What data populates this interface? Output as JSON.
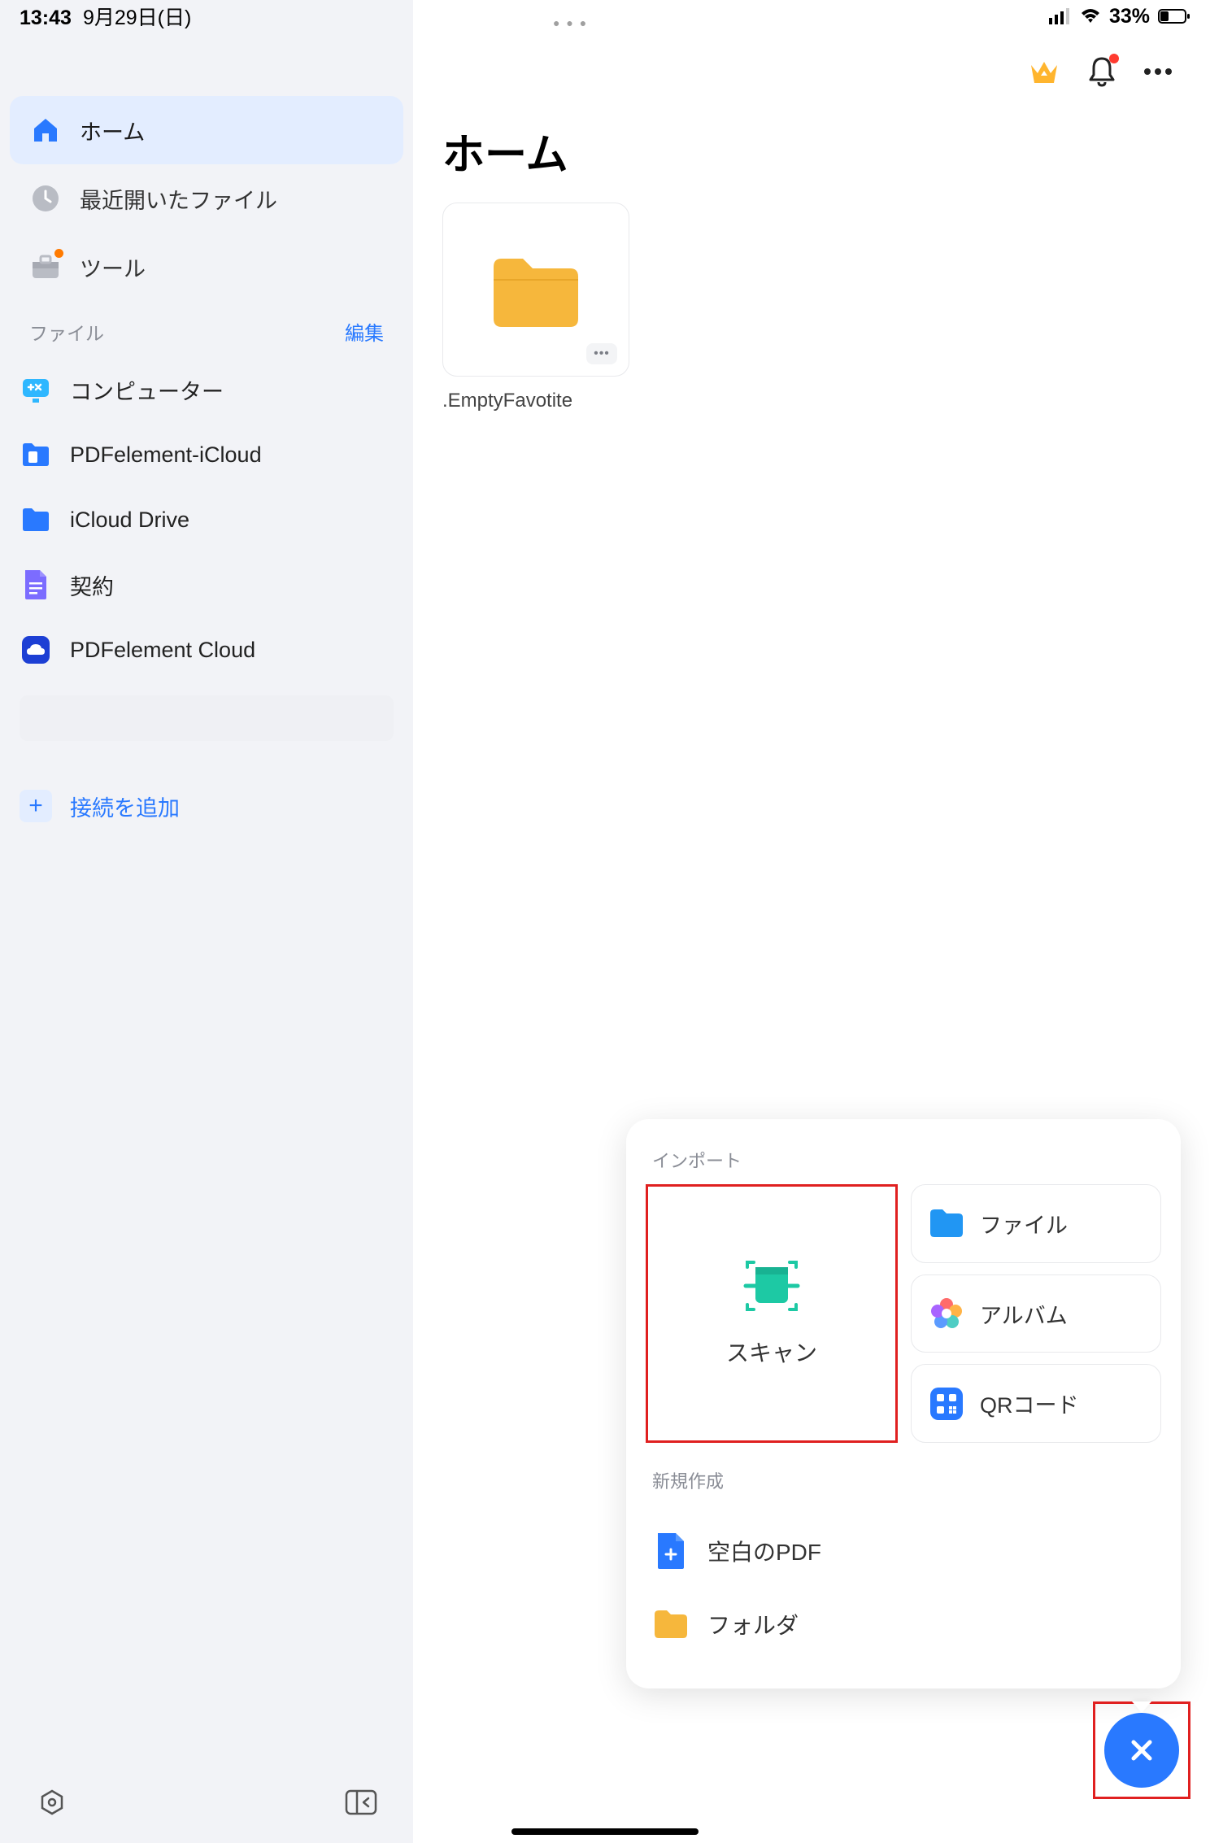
{
  "status": {
    "time": "13:43",
    "date": "9月29日(日)",
    "battery": "33%"
  },
  "sidebar": {
    "nav": [
      {
        "label": "ホーム",
        "icon": "home",
        "selected": true
      },
      {
        "label": "最近開いたファイル",
        "icon": "clock",
        "selected": false
      },
      {
        "label": "ツール",
        "icon": "toolbox",
        "selected": false,
        "badge": true
      }
    ],
    "section": {
      "title": "ファイル",
      "edit": "編集"
    },
    "files": [
      {
        "label": "コンピューター",
        "icon": "computer"
      },
      {
        "label": "PDFelement-iCloud",
        "icon": "pdf-folder"
      },
      {
        "label": "iCloud Drive",
        "icon": "icloud"
      },
      {
        "label": "契約",
        "icon": "doc"
      },
      {
        "label": "PDFelement Cloud",
        "icon": "cloud"
      }
    ],
    "add": {
      "label": "接続を追加"
    }
  },
  "main": {
    "title": "ホーム",
    "card": {
      "label": ".EmptyFavotite"
    }
  },
  "popup": {
    "import_title": "インポート",
    "scan": "スキャン",
    "file": "ファイル",
    "album": "アルバム",
    "qr": "QRコード",
    "create_title": "新規作成",
    "blank_pdf": "空白のPDF",
    "folder": "フォルダ"
  }
}
